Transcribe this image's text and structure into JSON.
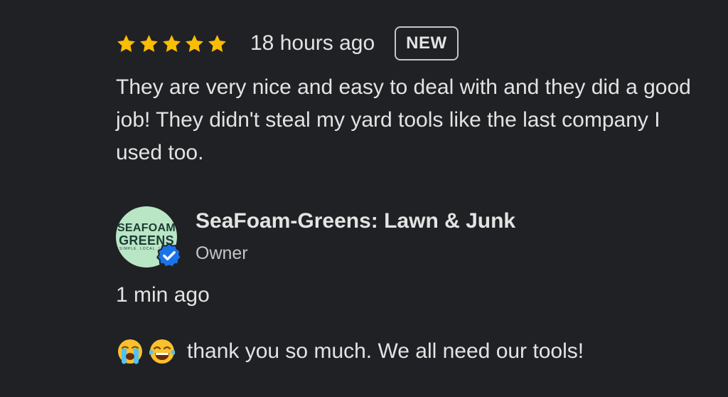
{
  "review": {
    "rating": 5,
    "rating_max": 5,
    "star_color": "#fbbc04",
    "time": "18 hours ago",
    "badge": "NEW",
    "text": "They are very nice and easy to deal with and they did a good job! They didn't steal my yard tools like the last company I used too."
  },
  "owner_reply": {
    "avatar": {
      "logo_line1": "SEAFOAM",
      "logo_line2": "GREENS",
      "logo_line3": "SIMPLE. LOCAL. LAWN.",
      "verified_icon": "verified-check-icon",
      "verified_color": "#1a73e8"
    },
    "name": "SeaFoam-Greens: Lawn & Junk",
    "role": "Owner",
    "time": "1 min ago",
    "emojis": [
      "loudly-crying-face-icon",
      "tears-of-joy-face-icon"
    ],
    "text": "thank you so much. We all need our tools!"
  }
}
